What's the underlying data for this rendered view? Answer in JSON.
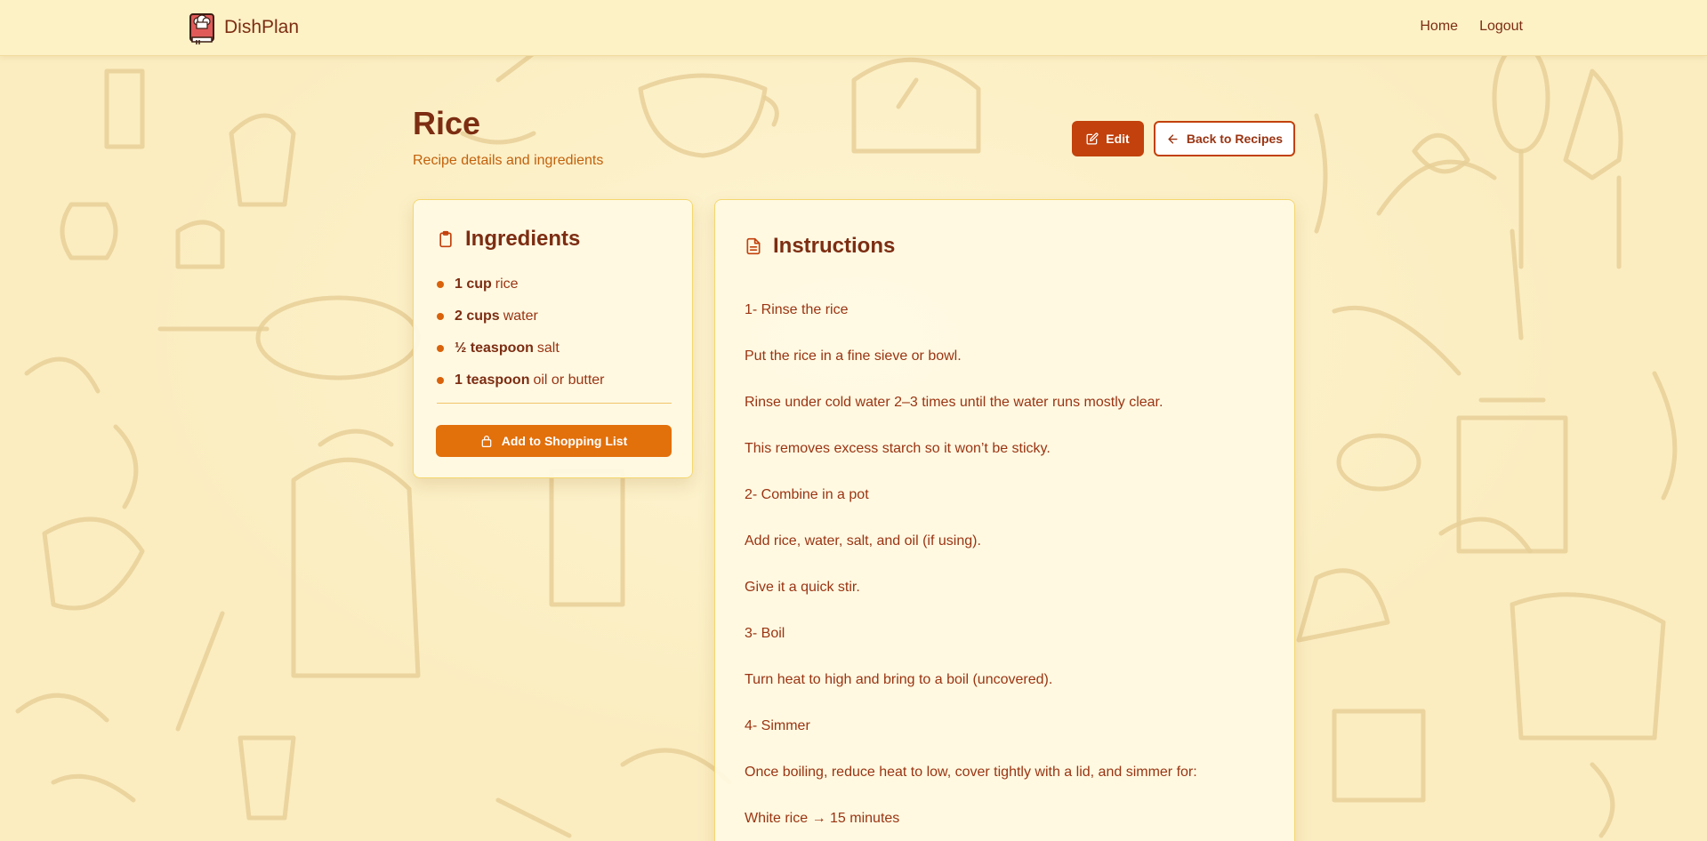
{
  "navbar": {
    "brand": "DishPlan",
    "links": [
      "Home",
      "Logout"
    ]
  },
  "header": {
    "title": "Rice",
    "subtitle": "Recipe details and ingredients",
    "edit_label": "Edit",
    "back_label": "Back to Recipes"
  },
  "ingredients": {
    "title": "Ingredients",
    "items": [
      {
        "qty": "1 cup",
        "name": "rice"
      },
      {
        "qty": "2 cups",
        "name": "water"
      },
      {
        "qty": "½ teaspoon",
        "name": "salt"
      },
      {
        "qty": "1 teaspoon",
        "name": "oil or butter"
      }
    ],
    "shopping_label": "Add to Shopping List"
  },
  "instructions": {
    "title": "Instructions",
    "lines": [
      "1- Rinse the rice",
      "Put the rice in a fine sieve or bowl.",
      "Rinse under cold water 2–3 times until the water runs mostly clear.",
      "This removes excess starch so it won’t be sticky.",
      "2- Combine in a pot",
      "Add rice, water, salt, and oil (if using).",
      "Give it a quick stir.",
      "3- Boil",
      "Turn heat to high and bring to a boil (uncovered).",
      "4- Simmer",
      "Once boiling, reduce heat to low, cover tightly with a lid, and simmer for:",
      "White rice → 15 minutes"
    ]
  },
  "icons": {
    "brand": "chef-cookbook-icon",
    "edit": "edit-icon",
    "back": "arrow-left-icon",
    "ingredients": "clipboard-icon",
    "instructions": "document-icon",
    "shopping": "shopping-bag-icon"
  },
  "colors": {
    "background": "#fbedc0",
    "accent": "#c2410c",
    "button_orange": "#e2700b",
    "text_dark": "#7c2d12",
    "card_border": "#f5d76e"
  }
}
